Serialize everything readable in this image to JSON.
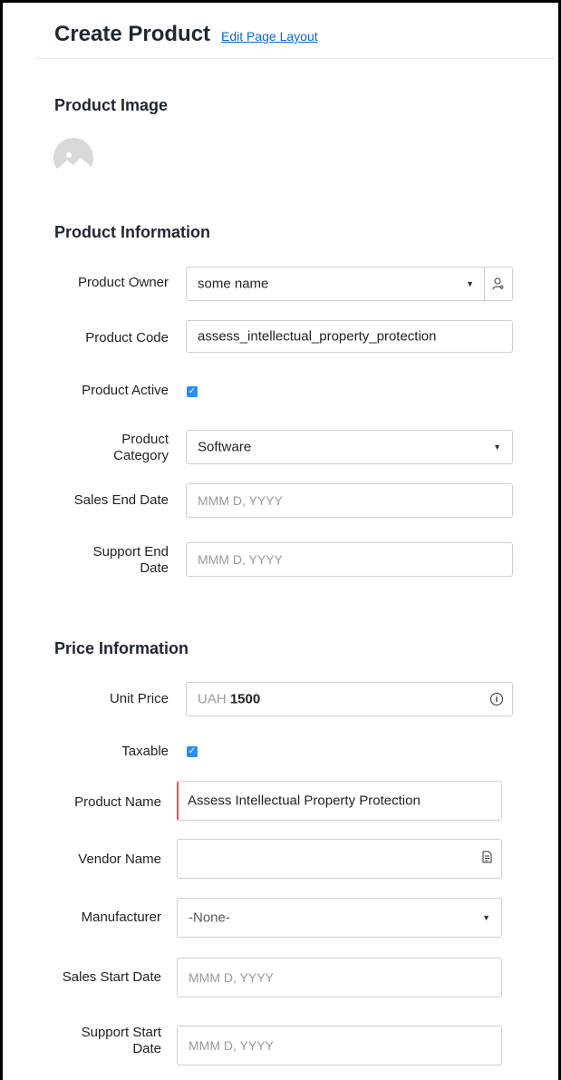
{
  "header": {
    "title": "Create Product",
    "edit_link": "Edit Page Layout"
  },
  "sections": {
    "image": "Product Image",
    "info": "Product Information",
    "price": "Price Information"
  },
  "fields": {
    "owner": {
      "label": "Product Owner",
      "value": "some name"
    },
    "code": {
      "label": "Product Code",
      "value": "assess_intellectual_property_protection"
    },
    "active": {
      "label": "Product Active",
      "checked": true
    },
    "category": {
      "label_line1": "Product",
      "label_line2": "Category",
      "value": "Software"
    },
    "sales_end": {
      "label": "Sales End Date",
      "placeholder": "MMM D, YYYY"
    },
    "support_end": {
      "label_line1": "Support End",
      "label_line2": "Date",
      "placeholder": "MMM D, YYYY"
    },
    "unit_price": {
      "label": "Unit Price",
      "currency": "UAH",
      "value": "1500"
    },
    "taxable": {
      "label": "Taxable",
      "checked": true
    },
    "product_name": {
      "label": "Product Name",
      "value": "Assess Intellectual Property Protection"
    },
    "vendor": {
      "label": "Vendor Name",
      "value": ""
    },
    "manufacturer": {
      "label": "Manufacturer",
      "value": "-None-"
    },
    "sales_start": {
      "label": "Sales Start Date",
      "placeholder": "MMM D, YYYY"
    },
    "support_start": {
      "label_line1": "Support Start",
      "label_line2": "Date",
      "placeholder": "MMM D, YYYY"
    }
  },
  "icons": {
    "owner_lookup": "user-search-icon",
    "unit_price_info": "info-icon",
    "vendor_lookup": "lookup-document-icon",
    "dropdown": "caret-down-icon",
    "image": "image-placeholder-icon"
  },
  "colors": {
    "link": "#0a66d6",
    "checkbox": "#2d8cf0",
    "required": "#e5484d"
  }
}
